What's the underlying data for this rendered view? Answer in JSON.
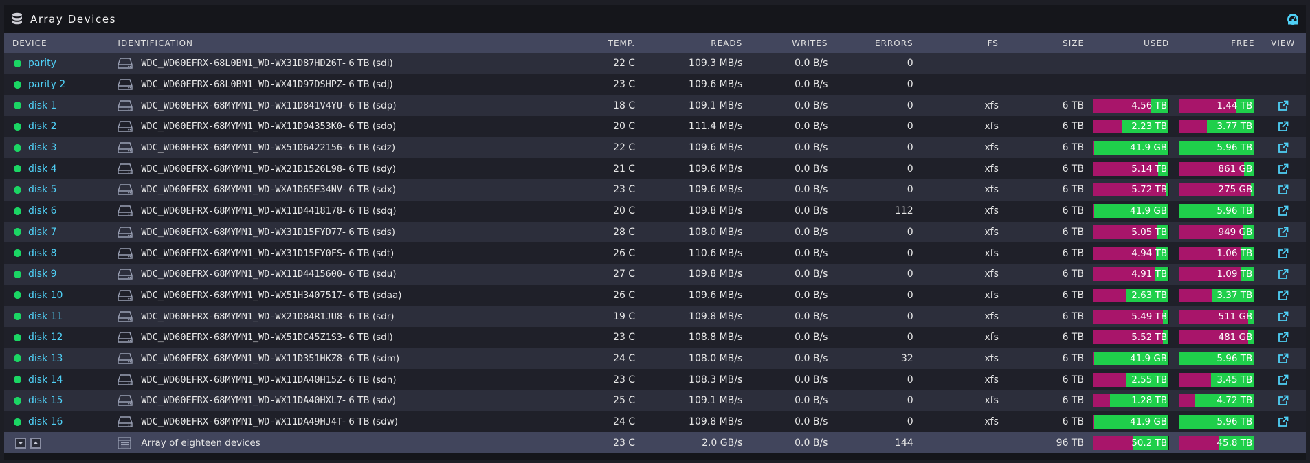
{
  "panel": {
    "title": "Array Devices"
  },
  "colors": {
    "used": "#a8156a",
    "free": "#1fcf4b",
    "accent": "#4fd0f6",
    "status": "#1bd664"
  },
  "columns": {
    "device": "DEVICE",
    "identification": "IDENTIFICATION",
    "temp": "TEMP.",
    "reads": "READS",
    "writes": "WRITES",
    "errors": "ERRORS",
    "fs": "FS",
    "size": "SIZE",
    "used": "USED",
    "free": "FREE",
    "view": "VIEW"
  },
  "rows": [
    {
      "name": "parity",
      "id": "WDC_WD60EFRX-68L0BN1_WD-WX31D87HD26T",
      "cap": " - 6 TB (sdi)",
      "temp": "22 C",
      "reads": "109.3 MB/s",
      "writes": "0.0 B/s",
      "errors": "0",
      "fs": "",
      "size": "",
      "used": "",
      "free": "",
      "used_frac": 0,
      "free_frac": 0,
      "bars": false
    },
    {
      "name": "parity 2",
      "id": "WDC_WD60EFRX-68L0BN1_WD-WX41D97DSHPZ",
      "cap": " - 6 TB (sdj)",
      "temp": "23 C",
      "reads": "109.6 MB/s",
      "writes": "0.0 B/s",
      "errors": "0",
      "fs": "",
      "size": "",
      "used": "",
      "free": "",
      "used_frac": 0,
      "free_frac": 0,
      "bars": false
    },
    {
      "name": "disk 1",
      "id": "WDC_WD60EFRX-68MYMN1_WD-WX11D841V4YU",
      "cap": " - 6 TB (sdp)",
      "temp": "18 C",
      "reads": "109.1 MB/s",
      "writes": "0.0 B/s",
      "errors": "0",
      "fs": "xfs",
      "size": "6 TB",
      "used": "4.56 TB",
      "free": "1.44 TB",
      "used_frac": 0.76,
      "free_frac": 0.24,
      "bars": true
    },
    {
      "name": "disk 2",
      "id": "WDC_WD60EFRX-68MYMN1_WD-WX11D94353K0",
      "cap": " - 6 TB (sdo)",
      "temp": "20 C",
      "reads": "111.4 MB/s",
      "writes": "0.0 B/s",
      "errors": "0",
      "fs": "xfs",
      "size": "6 TB",
      "used": "2.23 TB",
      "free": "3.77 TB",
      "used_frac": 0.372,
      "free_frac": 0.628,
      "bars": true
    },
    {
      "name": "disk 3",
      "id": "WDC_WD60EFRX-68MYMN1_WD-WX51D6422156",
      "cap": " - 6 TB (sdz)",
      "temp": "22 C",
      "reads": "109.6 MB/s",
      "writes": "0.0 B/s",
      "errors": "0",
      "fs": "xfs",
      "size": "6 TB",
      "used": "41.9 GB",
      "free": "5.96 TB",
      "used_frac": 0.007,
      "free_frac": 0.993,
      "bars": true
    },
    {
      "name": "disk 4",
      "id": "WDC_WD60EFRX-68MYMN1_WD-WX21D1526L98",
      "cap": " - 6 TB (sdy)",
      "temp": "21 C",
      "reads": "109.6 MB/s",
      "writes": "0.0 B/s",
      "errors": "0",
      "fs": "xfs",
      "size": "6 TB",
      "used": "5.14 TB",
      "free": "861 GB",
      "used_frac": 0.857,
      "free_frac": 0.143,
      "bars": true
    },
    {
      "name": "disk 5",
      "id": "WDC_WD60EFRX-68MYMN1_WD-WXA1D65E34NV",
      "cap": " - 6 TB (sdx)",
      "temp": "23 C",
      "reads": "109.6 MB/s",
      "writes": "0.0 B/s",
      "errors": "0",
      "fs": "xfs",
      "size": "6 TB",
      "used": "5.72 TB",
      "free": "275 GB",
      "used_frac": 0.953,
      "free_frac": 0.047,
      "bars": true
    },
    {
      "name": "disk 6",
      "id": "WDC_WD60EFRX-68MYMN1_WD-WX11D4418178",
      "cap": " - 6 TB (sdq)",
      "temp": "20 C",
      "reads": "109.8 MB/s",
      "writes": "0.0 B/s",
      "errors": "112",
      "fs": "xfs",
      "size": "6 TB",
      "used": "41.9 GB",
      "free": "5.96 TB",
      "used_frac": 0.007,
      "free_frac": 0.993,
      "bars": true
    },
    {
      "name": "disk 7",
      "id": "WDC_WD60EFRX-68MYMN1_WD-WX31D15FYD77",
      "cap": " - 6 TB (sds)",
      "temp": "28 C",
      "reads": "108.0 MB/s",
      "writes": "0.0 B/s",
      "errors": "0",
      "fs": "xfs",
      "size": "6 TB",
      "used": "5.05 TB",
      "free": "949 GB",
      "used_frac": 0.842,
      "free_frac": 0.158,
      "bars": true
    },
    {
      "name": "disk 8",
      "id": "WDC_WD60EFRX-68MYMN1_WD-WX31D15FY0FS",
      "cap": " - 6 TB (sdt)",
      "temp": "26 C",
      "reads": "110.6 MB/s",
      "writes": "0.0 B/s",
      "errors": "0",
      "fs": "xfs",
      "size": "6 TB",
      "used": "4.94 TB",
      "free": "1.06 TB",
      "used_frac": 0.823,
      "free_frac": 0.177,
      "bars": true
    },
    {
      "name": "disk 9",
      "id": "WDC_WD60EFRX-68MYMN1_WD-WX11D4415600",
      "cap": " - 6 TB (sdu)",
      "temp": "27 C",
      "reads": "109.8 MB/s",
      "writes": "0.0 B/s",
      "errors": "0",
      "fs": "xfs",
      "size": "6 TB",
      "used": "4.91 TB",
      "free": "1.09 TB",
      "used_frac": 0.818,
      "free_frac": 0.182,
      "bars": true
    },
    {
      "name": "disk 10",
      "id": "WDC_WD60EFRX-68MYMN1_WD-WX51H3407517",
      "cap": " - 6 TB (sdaa)",
      "temp": "26 C",
      "reads": "109.6 MB/s",
      "writes": "0.0 B/s",
      "errors": "0",
      "fs": "xfs",
      "size": "6 TB",
      "used": "2.63 TB",
      "free": "3.37 TB",
      "used_frac": 0.438,
      "free_frac": 0.562,
      "bars": true
    },
    {
      "name": "disk 11",
      "id": "WDC_WD60EFRX-68MYMN1_WD-WX21D84R1JU8",
      "cap": " - 6 TB (sdr)",
      "temp": "19 C",
      "reads": "109.8 MB/s",
      "writes": "0.0 B/s",
      "errors": "0",
      "fs": "xfs",
      "size": "6 TB",
      "used": "5.49 TB",
      "free": "511 GB",
      "used_frac": 0.915,
      "free_frac": 0.085,
      "bars": true
    },
    {
      "name": "disk 12",
      "id": "WDC_WD60EFRX-68MYMN1_WD-WX51DC45Z1S3",
      "cap": " - 6 TB (sdl)",
      "temp": "23 C",
      "reads": "108.8 MB/s",
      "writes": "0.0 B/s",
      "errors": "0",
      "fs": "xfs",
      "size": "6 TB",
      "used": "5.52 TB",
      "free": "481 GB",
      "used_frac": 0.92,
      "free_frac": 0.08,
      "bars": true
    },
    {
      "name": "disk 13",
      "id": "WDC_WD60EFRX-68MYMN1_WD-WX11D351HKZ8",
      "cap": " - 6 TB (sdm)",
      "temp": "24 C",
      "reads": "108.0 MB/s",
      "writes": "0.0 B/s",
      "errors": "32",
      "fs": "xfs",
      "size": "6 TB",
      "used": "41.9 GB",
      "free": "5.96 TB",
      "used_frac": 0.007,
      "free_frac": 0.993,
      "bars": true
    },
    {
      "name": "disk 14",
      "id": "WDC_WD60EFRX-68MYMN1_WD-WX11DA40H15Z",
      "cap": " - 6 TB (sdn)",
      "temp": "23 C",
      "reads": "108.3 MB/s",
      "writes": "0.0 B/s",
      "errors": "0",
      "fs": "xfs",
      "size": "6 TB",
      "used": "2.55 TB",
      "free": "3.45 TB",
      "used_frac": 0.425,
      "free_frac": 0.575,
      "bars": true
    },
    {
      "name": "disk 15",
      "id": "WDC_WD60EFRX-68MYMN1_WD-WX11DA40HXL7",
      "cap": " - 6 TB (sdv)",
      "temp": "25 C",
      "reads": "109.1 MB/s",
      "writes": "0.0 B/s",
      "errors": "0",
      "fs": "xfs",
      "size": "6 TB",
      "used": "1.28 TB",
      "free": "4.72 TB",
      "used_frac": 0.213,
      "free_frac": 0.787,
      "bars": true
    },
    {
      "name": "disk 16",
      "id": "WDC_WD60EFRX-68MYMN1_WD-WX11DA49HJ4T",
      "cap": " - 6 TB (sdw)",
      "temp": "24 C",
      "reads": "109.8 MB/s",
      "writes": "0.0 B/s",
      "errors": "0",
      "fs": "xfs",
      "size": "6 TB",
      "used": "41.9 GB",
      "free": "5.96 TB",
      "used_frac": 0.007,
      "free_frac": 0.993,
      "bars": true
    }
  ],
  "total": {
    "label": "Array of eighteen devices",
    "temp": "23 C",
    "reads": "2.0 GB/s",
    "writes": "0.0 B/s",
    "errors": "144",
    "fs": "",
    "size": "96 TB",
    "used": "50.2 TB",
    "free": "45.8 TB",
    "used_frac": 0.523,
    "free_frac": 0.477
  }
}
